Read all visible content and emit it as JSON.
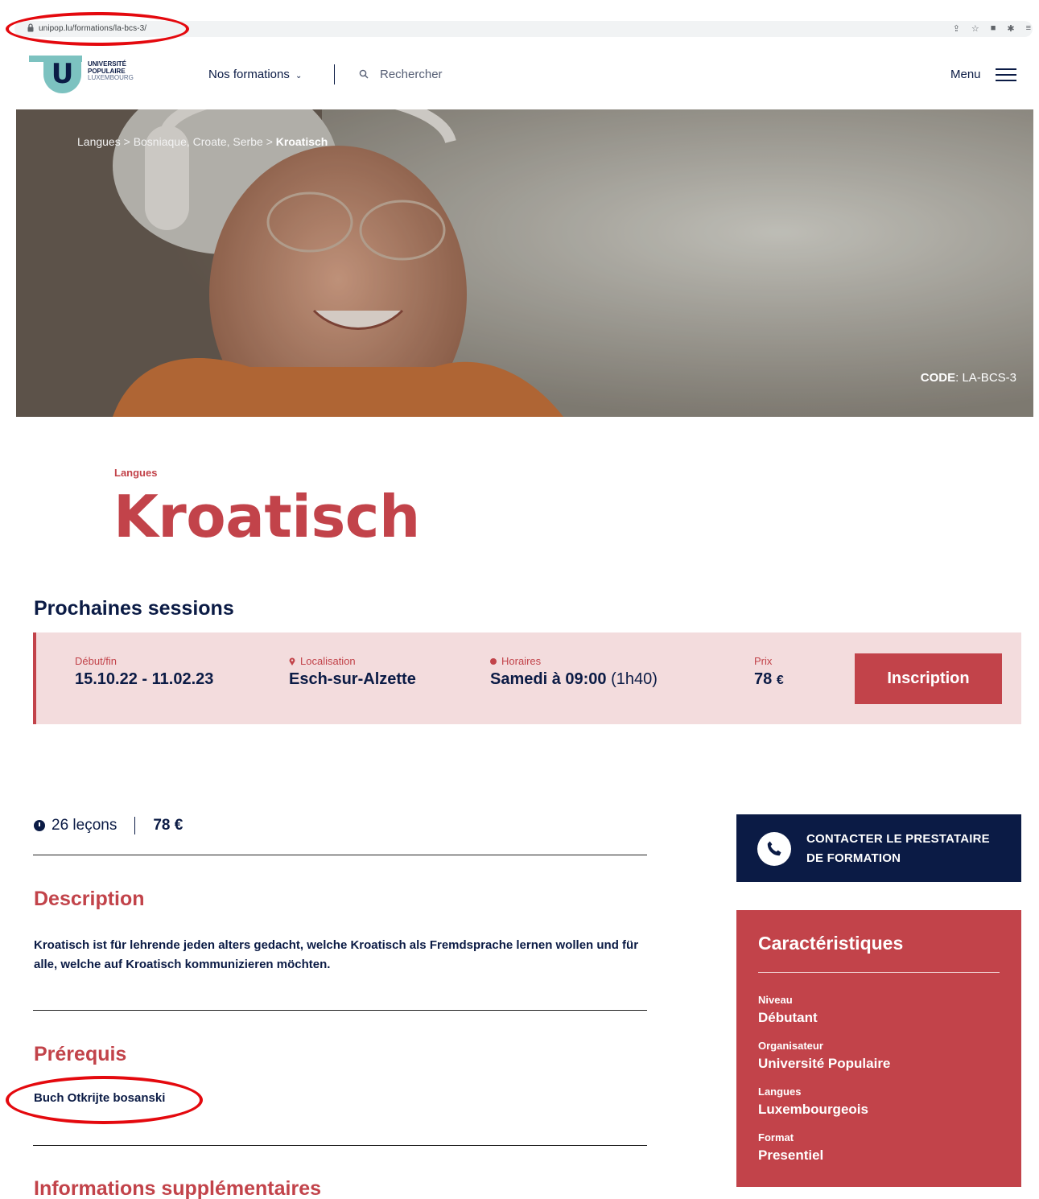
{
  "browser": {
    "url": "unipop.lu/formations/la-bcs-3/"
  },
  "header": {
    "logo_line1": "UNIVERSITÉ",
    "logo_line2": "POPULAIRE",
    "logo_line3": "LUXEMBOURG",
    "nav_formations": "Nos formations",
    "search_placeholder": "Rechercher",
    "menu_label": "Menu"
  },
  "hero": {
    "breadcrumb": [
      "Langues",
      "Bosniaque, Croate, Serbe",
      "Kroatisch"
    ],
    "code_label": "CODE",
    "code_value": "LA-BCS-3"
  },
  "course": {
    "category": "Langues",
    "title": "Kroatisch"
  },
  "sessions": {
    "title": "Prochaines sessions",
    "labels": {
      "dates": "Début/fin",
      "location": "Localisation",
      "schedule": "Horaires",
      "price": "Prix"
    },
    "item": {
      "dates": "15.10.22 - 11.02.23",
      "location": "Esch-sur-Alzette",
      "schedule": "Samedi à 09:00",
      "duration": "(1h40)",
      "price": "78",
      "currency": "€"
    },
    "button": "Inscription"
  },
  "meta": {
    "lessons": "26 leçons",
    "price": "78 €"
  },
  "description": {
    "title": "Description",
    "text": "Kroatisch ist für lehrende jeden alters gedacht, welche Kroatisch als Fremdsprache lernen wollen und für alle, welche auf Kroatisch kommunizieren möchten."
  },
  "prerequisites": {
    "title": "Prérequis",
    "text": "Buch Otkrijte bosanski"
  },
  "more_info": {
    "title": "Informations supplémentaires"
  },
  "contact": {
    "line1": "CONTACTER LE PRESTATAIRE",
    "line2": "DE FORMATION"
  },
  "characteristics": {
    "title": "Caractéristiques",
    "items": [
      {
        "label": "Niveau",
        "value": "Débutant"
      },
      {
        "label": "Organisateur",
        "value": "Université Populaire"
      },
      {
        "label": "Langues",
        "value": "Luxembourgeois"
      },
      {
        "label": "Format",
        "value": "Presentiel"
      }
    ]
  },
  "colors": {
    "brand_red": "#c2434a",
    "brand_navy": "#0b1b45",
    "session_bg": "#f3dcdd",
    "logo_teal": "#7cc2c0"
  }
}
